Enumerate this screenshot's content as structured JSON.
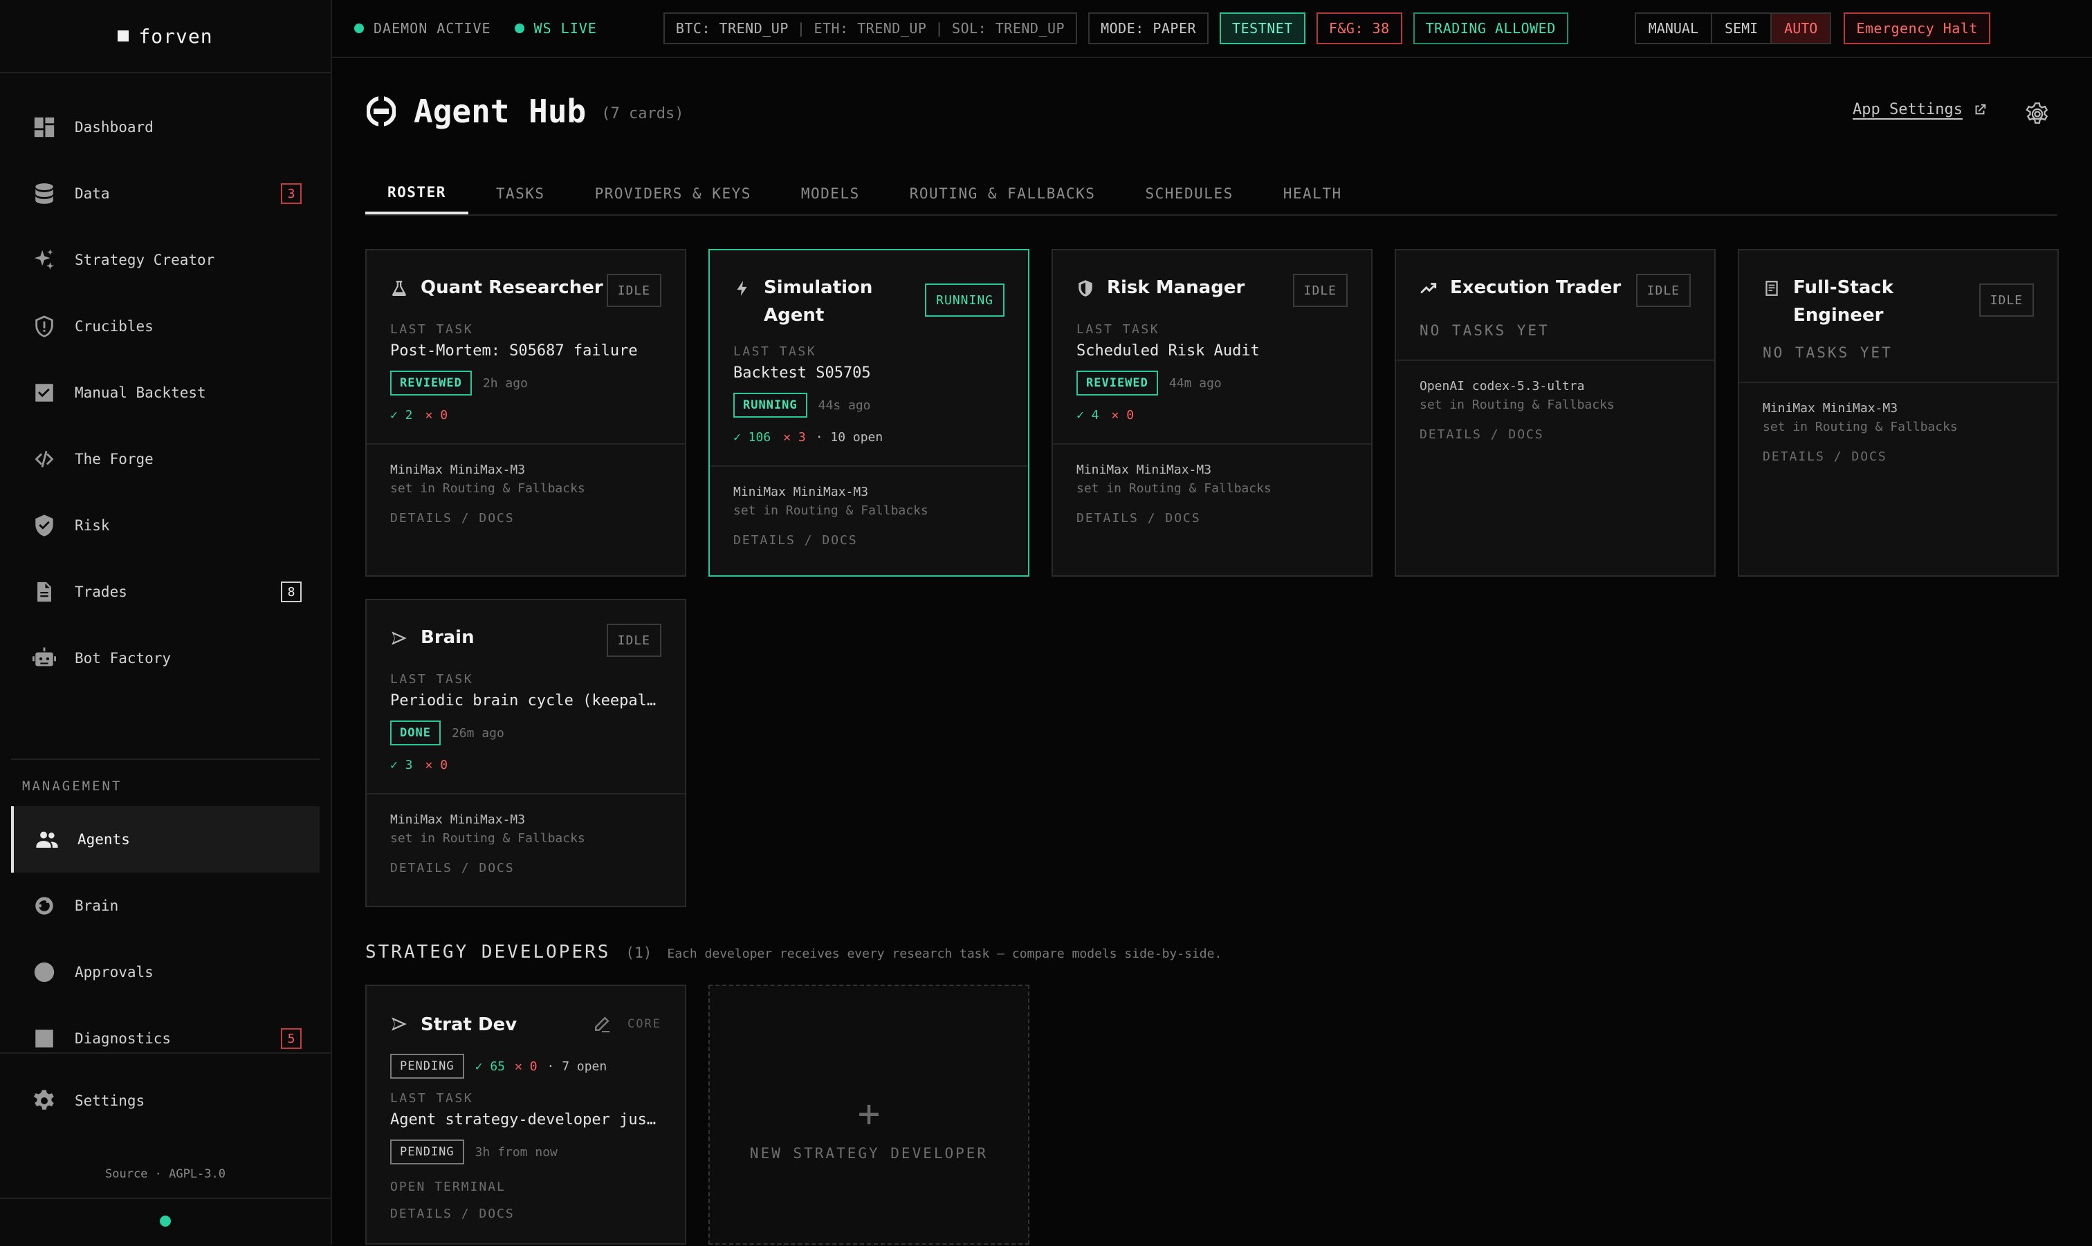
{
  "brand": {
    "name": "forven"
  },
  "sidebar": {
    "items": [
      {
        "label": "Dashboard",
        "icon": "dashboard-icon"
      },
      {
        "label": "Data",
        "icon": "database-icon",
        "badge": "3"
      },
      {
        "label": "Strategy Creator",
        "icon": "sparkle-icon"
      },
      {
        "label": "Crucibles",
        "icon": "shield-alert-icon"
      },
      {
        "label": "Manual Backtest",
        "icon": "checkbox-icon"
      },
      {
        "label": "The Forge",
        "icon": "code-icon"
      },
      {
        "label": "Risk",
        "icon": "shield-check-icon"
      },
      {
        "label": "Trades",
        "icon": "document-icon",
        "badge": "8"
      },
      {
        "label": "Bot Factory",
        "icon": "robot-icon"
      }
    ],
    "section_label": "MANAGEMENT",
    "mgmt_items": [
      {
        "label": "Agents",
        "icon": "people-icon",
        "active": true
      },
      {
        "label": "Brain",
        "icon": "brain-icon"
      },
      {
        "label": "Approvals",
        "icon": "circle-icon"
      },
      {
        "label": "Diagnostics",
        "icon": "diagnostics-icon",
        "badge": "5"
      }
    ],
    "settings_label": "Settings",
    "source_line": "Source · AGPL-3.0"
  },
  "topbar": {
    "daemon": "DAEMON ACTIVE",
    "ws": "WS LIVE",
    "trends": {
      "btc": "BTC: TREND_UP",
      "eth": "ETH: TREND_UP",
      "sol": "SOL: TREND_UP"
    },
    "mode": "MODE: PAPER",
    "network": "TESTNET",
    "fear_greed": "F&G: 38",
    "trading": "TRADING ALLOWED",
    "modes": [
      "MANUAL",
      "SEMI",
      "AUTO"
    ],
    "halt": "Emergency Halt"
  },
  "header": {
    "title": "Agent Hub",
    "count": "(7 cards)",
    "app_settings": "App Settings"
  },
  "tabs": [
    "ROSTER",
    "TASKS",
    "PROVIDERS & KEYS",
    "MODELS",
    "ROUTING & FALLBACKS",
    "SCHEDULES",
    "HEALTH"
  ],
  "common": {
    "last_task": "LAST TASK",
    "no_tasks": "NO TASKS YET",
    "model_note": "set in Routing & Fallbacks",
    "details": "DETAILS / DOCS"
  },
  "cards": {
    "quant": {
      "title": "Quant Researcher",
      "state": "IDLE",
      "task": "Post-Mortem: S05687 failure",
      "status": "REVIEWED",
      "ago": "2h ago",
      "ok": "✓ 2",
      "fail": "✕ 0",
      "model": "MiniMax MiniMax-M3"
    },
    "sim": {
      "title": "Simulation Agent",
      "state": "RUNNING",
      "task": "Backtest S05705",
      "status": "RUNNING",
      "ago": "44s ago",
      "ok": "✓ 106",
      "fail": "✕ 3",
      "open": "· 10 open",
      "model": "MiniMax MiniMax-M3"
    },
    "risk": {
      "title": "Risk Manager",
      "state": "IDLE",
      "task": "Scheduled Risk Audit",
      "status": "REVIEWED",
      "ago": "44m ago",
      "ok": "✓ 4",
      "fail": "✕ 0",
      "model": "MiniMax MiniMax-M3"
    },
    "exec": {
      "title": "Execution Trader",
      "state": "IDLE",
      "model": "OpenAI codex-5.3-ultra"
    },
    "fullstack": {
      "title": "Full-Stack Engineer",
      "state": "IDLE",
      "model": "MiniMax MiniMax-M3"
    },
    "brain": {
      "title": "Brain",
      "state": "IDLE",
      "task": "Periodic brain cycle (keepalive)",
      "status": "DONE",
      "ago": "26m ago",
      "ok": "✓ 3",
      "fail": "✕ 0",
      "model": "MiniMax MiniMax-M3"
    }
  },
  "strategy_devs": {
    "title": "STRATEGY DEVELOPERS",
    "count": "(1)",
    "description": "Each developer receives every research task — compare models side-by-side.",
    "card": {
      "title": "Strat Dev",
      "core": "CORE",
      "state": "PENDING",
      "ok": "✓ 65",
      "fail": "✕ 0",
      "open": "· 7 open",
      "task": "Agent strategy-developer just…",
      "status": "PENDING",
      "ago": "3h from now",
      "terminal": "OPEN TERMINAL"
    },
    "new_label": "NEW STRATEGY DEVELOPER"
  }
}
